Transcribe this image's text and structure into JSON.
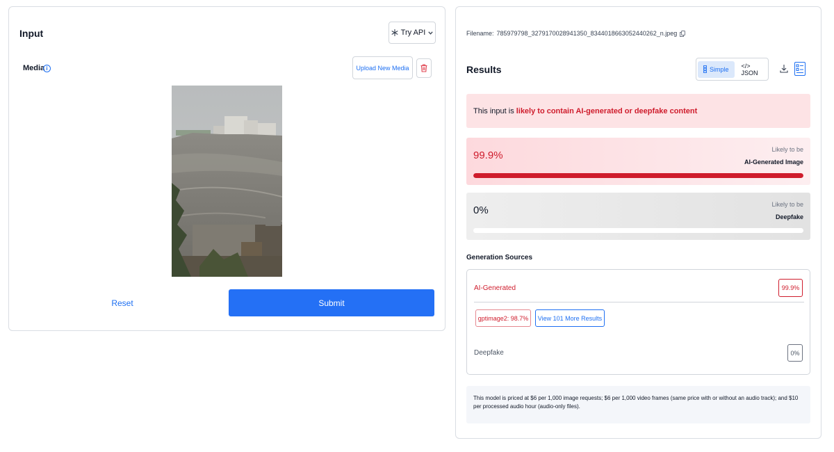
{
  "input": {
    "title": "Input",
    "try_api_label": "Try API",
    "media_label": "Media",
    "upload_label": "Upload New Media",
    "reset_label": "Reset",
    "submit_label": "Submit"
  },
  "results": {
    "filename_label": "Filename:",
    "filename": "785979798_3279170028941350_8344018663052440262_n.jpeg",
    "title": "Results",
    "view_toggle": {
      "simple_label": "Simple",
      "json_label": "</> JSON",
      "active": "Simple"
    },
    "alert": {
      "prefix": "This input is",
      "highlight": "likely to contain AI-generated or deepfake content"
    },
    "scores": [
      {
        "value_text": "99.9%",
        "value": 99.9,
        "likely_text": "Likely to be",
        "label": "AI-Generated Image"
      },
      {
        "value_text": "0%",
        "value": 0,
        "likely_text": "Likely to be",
        "label": "Deepfake"
      }
    ],
    "generation_sources": {
      "title": "Generation Sources",
      "ai_generated": {
        "label": "AI-Generated",
        "value": "99.9%"
      },
      "model_chip": "gptimage2: 98.7%",
      "more_results_label": "View 101 More Results",
      "deepfake": {
        "label": "Deepfake",
        "value": "0%"
      }
    },
    "pricing_note": "This model is priced at $6 per 1,000 image requests; $6 per 1,000 video frames (same price with or without an audio track); and $10 per processed audio hour (audio-only files)."
  },
  "colors": {
    "accent_blue": "#2470f5",
    "alert_red": "#cf1c2c",
    "alert_bg": "#fde3e5"
  }
}
